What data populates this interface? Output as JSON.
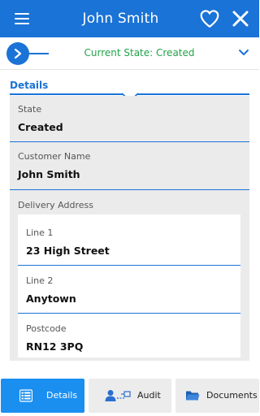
{
  "header": {
    "title": "John Smith",
    "menu_icon": "hamburger-menu-icon",
    "favorite_icon": "heart-outline-icon",
    "close_icon": "close-icon"
  },
  "state_bar": {
    "text": "Current State: Created",
    "expand_icon": "chevron-down-icon",
    "step_icon": "chevron-right-icon"
  },
  "details": {
    "section_title": "Details",
    "fields": [
      {
        "label": "State",
        "value": "Created"
      },
      {
        "label": "Customer Name",
        "value": "John Smith"
      }
    ],
    "delivery_address": {
      "label": "Delivery Address",
      "fields": [
        {
          "label": "Line 1",
          "value": "23 High Street"
        },
        {
          "label": "Line 2",
          "value": "Anytown"
        },
        {
          "label": "Postcode",
          "value": "RN12 3PQ"
        }
      ]
    }
  },
  "tabs": [
    {
      "label": "Details",
      "icon": "details-list-icon",
      "active": true
    },
    {
      "label": "Audit",
      "icon": "audit-user-icon",
      "active": false
    },
    {
      "label": "Documents",
      "icon": "folder-icon",
      "active": false
    }
  ],
  "colors": {
    "primary": "#1a73d6",
    "state_green": "#22a34a",
    "active_tab": "#1a8ff0",
    "panel_bg": "#ebebeb"
  }
}
